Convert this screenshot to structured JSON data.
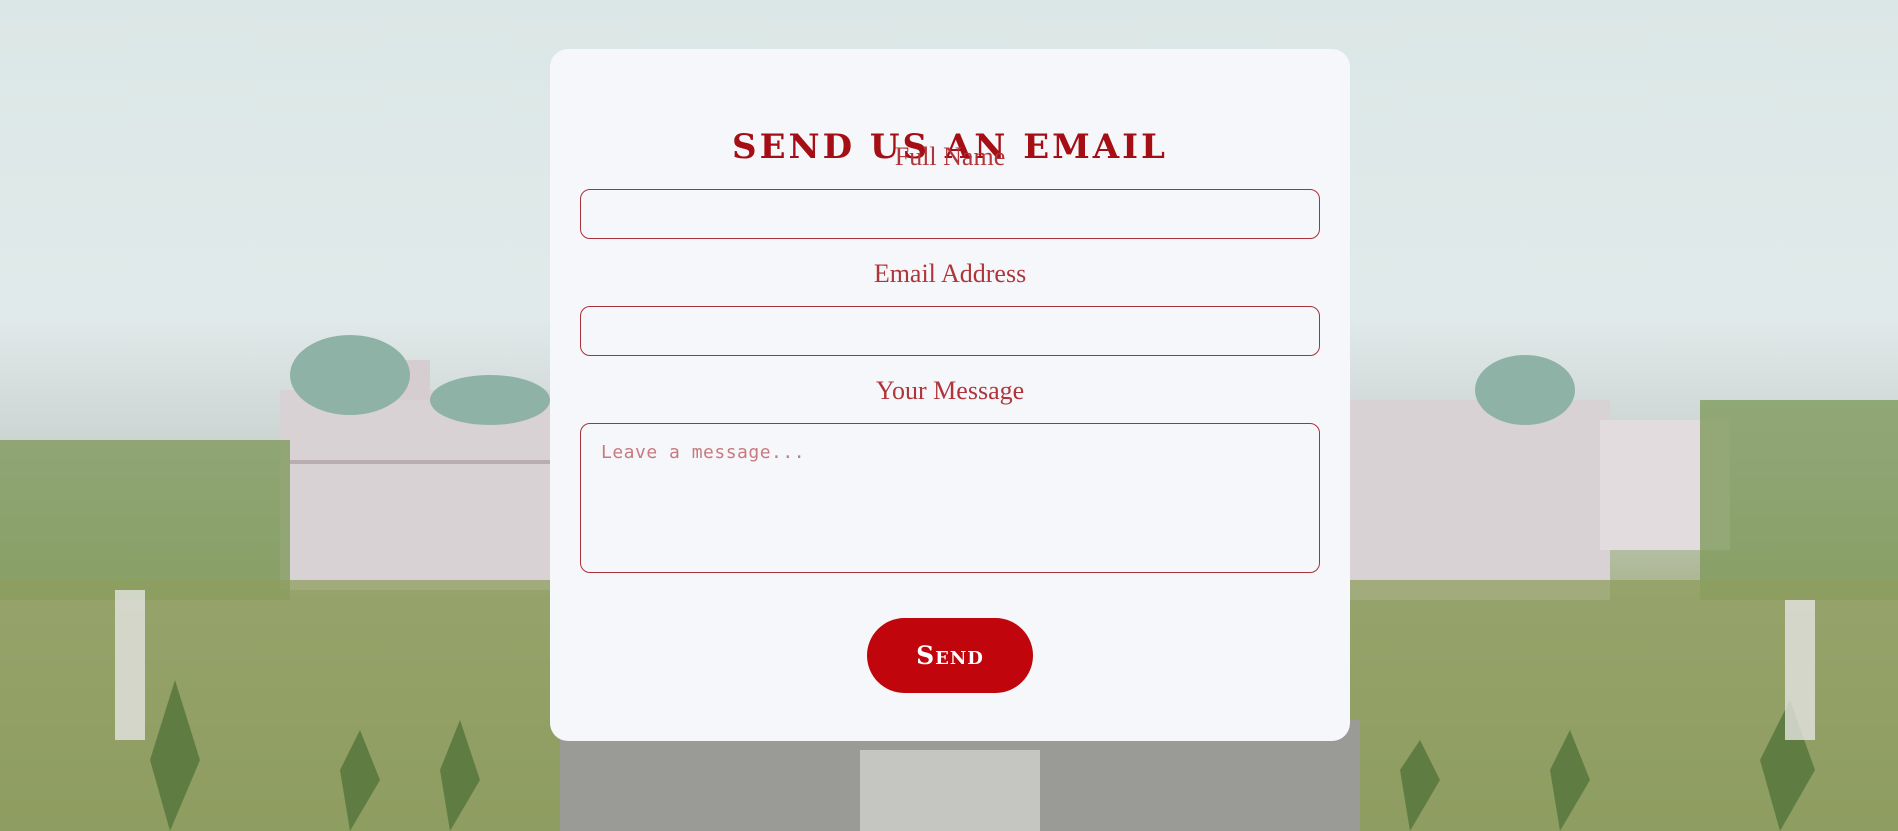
{
  "form": {
    "title": "SEND US AN EMAIL",
    "full_name_label": "Full Name",
    "full_name_value": "",
    "email_label": "Email Address",
    "email_value": "",
    "message_label": "Your Message",
    "message_placeholder": "Leave a message...",
    "send_label": "Send"
  },
  "colors": {
    "accent": "#a50e14",
    "button": "#c1050d",
    "card": "#f6f7fb",
    "border": "#a8323a"
  }
}
